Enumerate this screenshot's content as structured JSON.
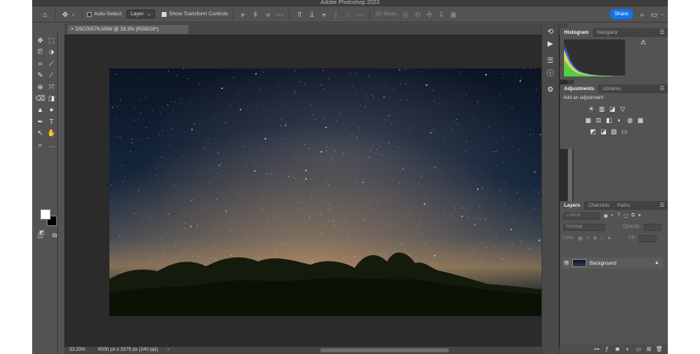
{
  "window": {
    "title": "Adobe Photoshop 2023"
  },
  "options_bar": {
    "auto_select_label": "Auto-Select:",
    "auto_select_value": "Layer",
    "show_transform_label": "Show Transform Controls",
    "mode_3d_label": "3D Mode:",
    "share_label": "Share"
  },
  "document": {
    "tab_title": "DSC00579.ARW @ 33.3% (RGB/16*)",
    "zoom": "33.33%",
    "info": "6000 px x 3375 px (240 ppi)"
  },
  "tools": [
    {
      "name": "move-tool",
      "glyph": "✥"
    },
    {
      "name": "artboard-tool",
      "glyph": "⬚"
    },
    {
      "name": "lasso-tool",
      "glyph": "ᘓ"
    },
    {
      "name": "object-selection-tool",
      "glyph": "⬗"
    },
    {
      "name": "crop-tool",
      "glyph": "⌗"
    },
    {
      "name": "eyedropper-tool",
      "glyph": "⟋"
    },
    {
      "name": "spot-healing-tool",
      "glyph": "✎"
    },
    {
      "name": "brush-tool",
      "glyph": "⁄"
    },
    {
      "name": "clone-stamp-tool",
      "glyph": "⊕"
    },
    {
      "name": "history-brush-tool",
      "glyph": "⤧"
    },
    {
      "name": "eraser-tool",
      "glyph": "⌫"
    },
    {
      "name": "gradient-tool",
      "glyph": "◨"
    },
    {
      "name": "blur-tool",
      "glyph": "▲"
    },
    {
      "name": "dodge-tool",
      "glyph": "●"
    },
    {
      "name": "pen-tool",
      "glyph": "✒"
    },
    {
      "name": "type-tool",
      "glyph": "T"
    },
    {
      "name": "path-selection-tool",
      "glyph": "↖"
    },
    {
      "name": "hand-tool",
      "glyph": "✋"
    },
    {
      "name": "zoom-tool",
      "glyph": "⌕"
    },
    {
      "name": "more-tools",
      "glyph": "…"
    }
  ],
  "panels": {
    "histogram": {
      "tabs": [
        "Histogram",
        "Navigator"
      ]
    },
    "adjustments": {
      "tabs": [
        "Adjustments",
        "Libraries"
      ],
      "hint": "Add an adjustment",
      "rows": [
        [
          "☀",
          "▥",
          "◪",
          "▽"
        ],
        [
          "▦",
          "⚖",
          "◧",
          "◐",
          "◍",
          "▦"
        ],
        [
          "◩",
          "◪",
          "▨",
          "▭"
        ]
      ]
    },
    "layers": {
      "tabs": [
        "Layers",
        "Channels",
        "Paths"
      ],
      "kind_placeholder": "Kind",
      "blend_mode": "Normal",
      "opacity_label": "Opacity:",
      "lock_label": "Lock:",
      "fill_label": "Fill:",
      "layer_name": "Background"
    }
  },
  "chart_data": {
    "type": "area",
    "series": [
      {
        "name": "luminance",
        "values": [
          92,
          70,
          48,
          34,
          24,
          17,
          13,
          10,
          8,
          6,
          5,
          4,
          3,
          3,
          2,
          2,
          2,
          1,
          1,
          1,
          1,
          1
        ]
      }
    ]
  }
}
